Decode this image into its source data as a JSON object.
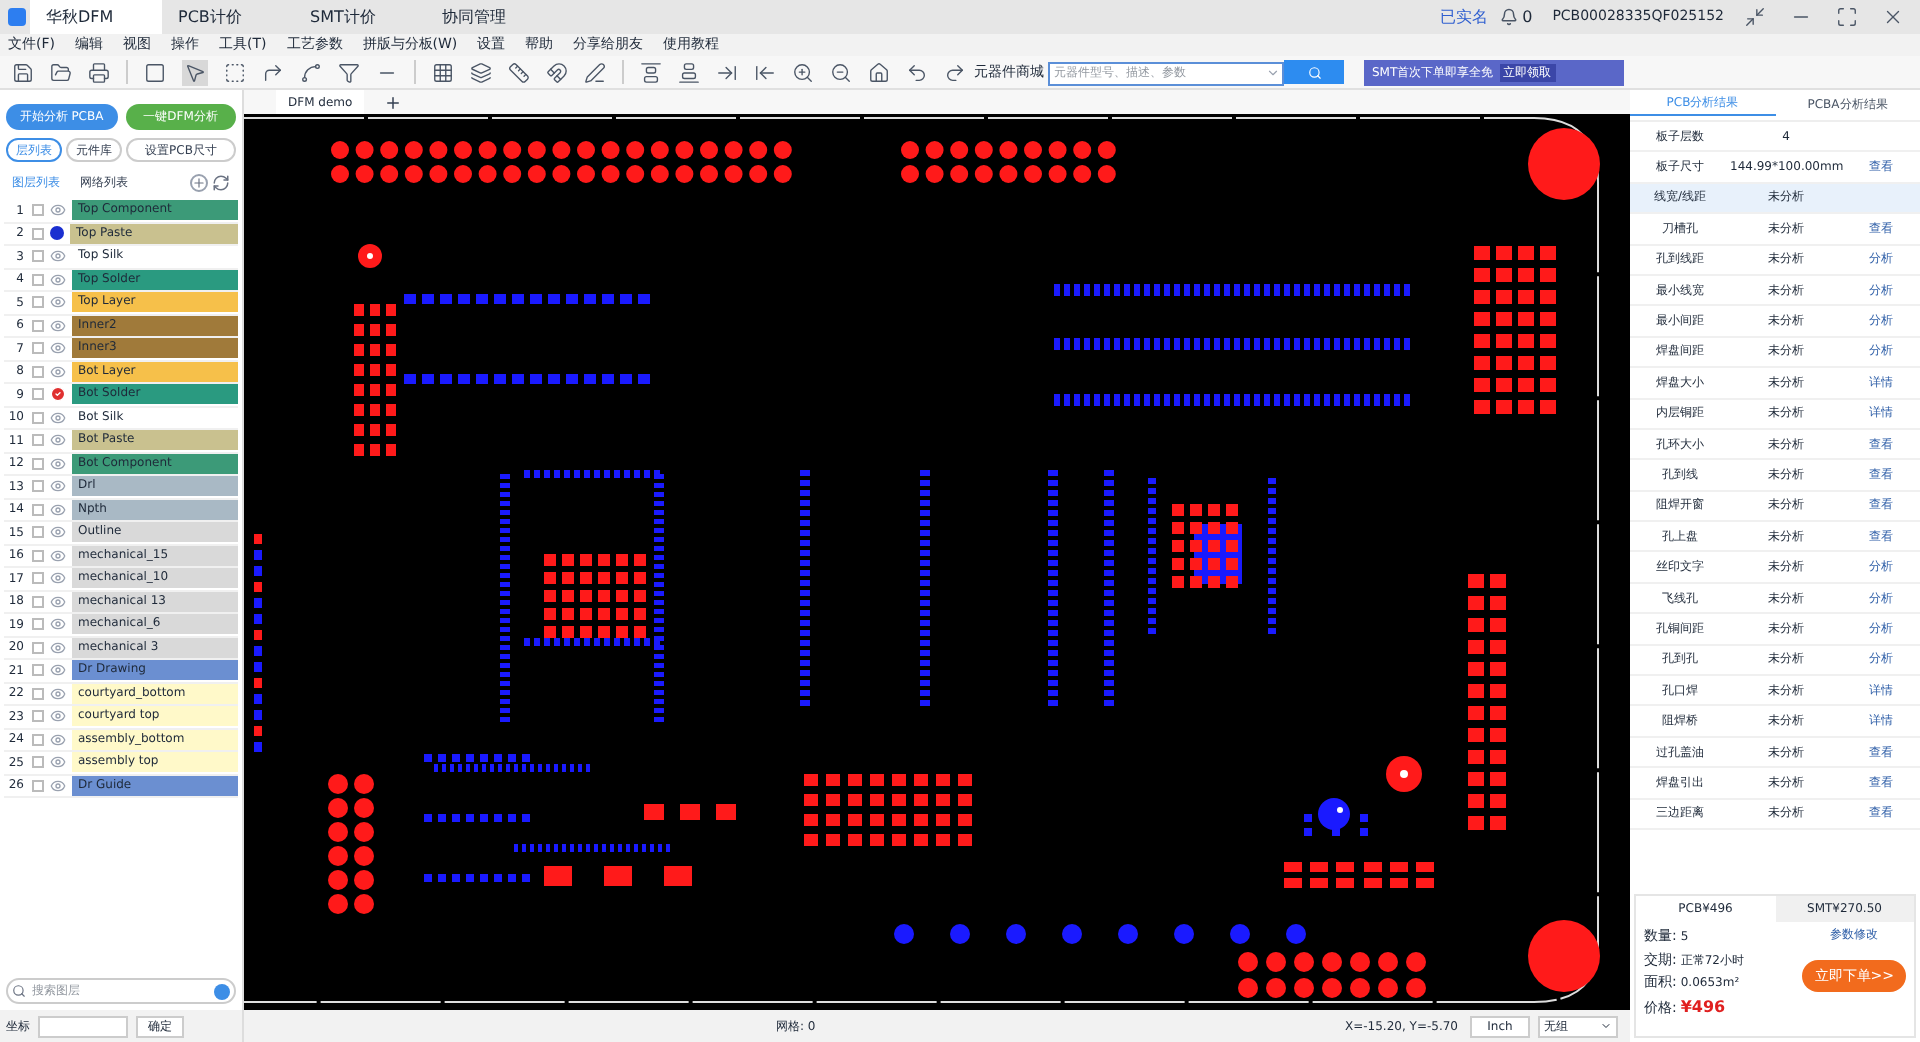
{
  "app_tabs": [
    {
      "label": "华秋DFM",
      "selected": true
    },
    {
      "label": "PCB计价",
      "selected": false
    },
    {
      "label": "SMT计价",
      "selected": false
    },
    {
      "label": "协同管理",
      "selected": false
    }
  ],
  "account": {
    "verified": "已实名",
    "notifications": "0",
    "user": "PCB00028335QF025152"
  },
  "menu": [
    "文件(F)",
    "编辑",
    "视图",
    "操作",
    "工具(T)",
    "工艺参数",
    "拼版与分板(W)",
    "设置",
    "帮助",
    "分享给朋友",
    "使用教程"
  ],
  "parts_search": {
    "label": "元器件商城",
    "placeholder": "元器件型号、描述、参数"
  },
  "banner": {
    "text": "SMT首次下单即享全免",
    "action": "立即领取"
  },
  "actions": [
    "开始分析 PCBA",
    "一键DFM分析"
  ],
  "left_tabs": [
    {
      "label": "层列表",
      "selected": true
    },
    {
      "label": "元件库",
      "selected": false
    },
    {
      "label": "设置PCB尺寸",
      "selected": false
    }
  ],
  "layer_header": {
    "tabs": [
      {
        "label": "图层列表",
        "selected": true
      },
      {
        "label": "网络列表",
        "selected": false
      }
    ]
  },
  "layers": [
    {
      "index": "1",
      "name": "Top Component",
      "color": "#3c9a78",
      "kind": "eye",
      "checked": false
    },
    {
      "index": "2",
      "name": "Top Paste",
      "color": "#c9c18f",
      "kind": "current",
      "checked": false
    },
    {
      "index": "3",
      "name": "Top Silk",
      "color": "#ffffff",
      "kind": "eye",
      "checked": false
    },
    {
      "index": "4",
      "name": "Top Solder",
      "color": "#2a9a80",
      "kind": "eye",
      "checked": false
    },
    {
      "index": "5",
      "name": "Top Layer",
      "color": "#f6c04a",
      "kind": "eye",
      "checked": false
    },
    {
      "index": "6",
      "name": "Inner2",
      "color": "#a07a3a",
      "kind": "eye",
      "checked": false
    },
    {
      "index": "7",
      "name": "Inner3",
      "color": "#a07a3a",
      "kind": "eye",
      "checked": false
    },
    {
      "index": "8",
      "name": "Bot Layer",
      "color": "#f6c04a",
      "kind": "eye",
      "checked": false
    },
    {
      "index": "9",
      "name": "Bot Solder",
      "color": "#2a9a80",
      "kind": "warning",
      "checked": false
    },
    {
      "index": "10",
      "name": "Bot Silk",
      "color": "#ffffff",
      "kind": "eye",
      "checked": false
    },
    {
      "index": "11",
      "name": "Bot Paste",
      "color": "#c9c18f",
      "kind": "eye",
      "checked": false
    },
    {
      "index": "12",
      "name": "Bot Component",
      "color": "#3c9a78",
      "kind": "eye",
      "checked": false
    },
    {
      "index": "13",
      "name": "Drl",
      "color": "#a9b9c5",
      "kind": "eye",
      "checked": false
    },
    {
      "index": "14",
      "name": "Npth",
      "color": "#a9b9c5",
      "kind": "eye",
      "checked": false
    },
    {
      "index": "15",
      "name": "Outline",
      "color": "#d9d9d9",
      "kind": "eye",
      "checked": false
    },
    {
      "index": "16",
      "name": "mechanical_15",
      "color": "#d9d9d9",
      "kind": "eye",
      "checked": false
    },
    {
      "index": "17",
      "name": "mechanical_10",
      "color": "#d9d9d9",
      "kind": "eye",
      "checked": false
    },
    {
      "index": "18",
      "name": "mechanical 13",
      "color": "#d9d9d9",
      "kind": "eye",
      "checked": false
    },
    {
      "index": "19",
      "name": "mechanical_6",
      "color": "#d9d9d9",
      "kind": "eye",
      "checked": false
    },
    {
      "index": "20",
      "name": "mechanical 3",
      "color": "#d9d9d9",
      "kind": "eye",
      "checked": false
    },
    {
      "index": "21",
      "name": "Dr Drawing",
      "color": "#6b8fd1",
      "kind": "eye",
      "checked": false
    },
    {
      "index": "22",
      "name": "courtyard_bottom",
      "color": "#fff9c9",
      "kind": "eye",
      "checked": false
    },
    {
      "index": "23",
      "name": "courtyard top",
      "color": "#fff9c9",
      "kind": "eye",
      "checked": false
    },
    {
      "index": "24",
      "name": "assembly_bottom",
      "color": "#fff9c9",
      "kind": "eye",
      "checked": false
    },
    {
      "index": "25",
      "name": "assembly top",
      "color": "#fff9c9",
      "kind": "eye",
      "checked": false
    },
    {
      "index": "26",
      "name": "Dr Guide",
      "color": "#6b8fd1",
      "kind": "eye",
      "checked": false
    }
  ],
  "layer_search": {
    "placeholder": "搜索图层"
  },
  "coordinate": {
    "label": "坐标",
    "button": "确定"
  },
  "doc_tabs": [
    {
      "label": "DFM demo",
      "selected": true
    }
  ],
  "status_bar": {
    "grid": "网格: 0",
    "position": "X=-15.20, Y=-5.70",
    "unit": "Inch",
    "mode": "无组"
  },
  "result_tabs": [
    {
      "label": "PCB分析结果",
      "selected": true
    },
    {
      "label": "PCBA分析结果",
      "selected": false
    }
  ],
  "results": [
    {
      "item": "板子层数",
      "value": "4",
      "selected": false
    },
    {
      "item": "板子尺寸",
      "value": "144.99*100.00mm",
      "action": "查看",
      "selected": false
    },
    {
      "item": "线宽/线距",
      "value": "未分析",
      "selected": true
    },
    {
      "item": "刀槽孔",
      "value": "未分析",
      "action": "查看",
      "selected": false
    },
    {
      "item": "孔到线距",
      "value": "未分析",
      "action": "分析",
      "selected": false
    },
    {
      "item": "最小线宽",
      "value": "未分析",
      "action": "分析",
      "selected": false
    },
    {
      "item": "最小间距",
      "value": "未分析",
      "action": "分析",
      "selected": false
    },
    {
      "item": "焊盘间距",
      "value": "未分析",
      "action": "分析",
      "selected": false
    },
    {
      "item": "焊盘大小",
      "value": "未分析",
      "action": "详情",
      "selected": false
    },
    {
      "item": "内层铜距",
      "value": "未分析",
      "action": "详情",
      "selected": false
    },
    {
      "item": "孔环大小",
      "value": "未分析",
      "action": "查看",
      "selected": false
    },
    {
      "item": "孔到线",
      "value": "未分析",
      "action": "查看",
      "selected": false
    },
    {
      "item": "阻焊开窗",
      "value": "未分析",
      "action": "查看",
      "selected": false
    },
    {
      "item": "孔上盘",
      "value": "未分析",
      "action": "查看",
      "selected": false
    },
    {
      "item": "丝印文字",
      "value": "未分析",
      "action": "分析",
      "selected": false
    },
    {
      "item": "飞线孔",
      "value": "未分析",
      "action": "分析",
      "selected": false
    },
    {
      "item": "孔铜间距",
      "value": "未分析",
      "action": "分析",
      "selected": false
    },
    {
      "item": "孔到孔",
      "value": "未分析",
      "action": "分析",
      "selected": false
    },
    {
      "item": "孔口焊",
      "value": "未分析",
      "action": "详情",
      "selected": false
    },
    {
      "item": "阻焊桥",
      "value": "未分析",
      "action": "详情",
      "selected": false
    },
    {
      "item": "过孔盖油",
      "value": "未分析",
      "action": "查看",
      "selected": false
    },
    {
      "item": "焊盘引出",
      "value": "未分析",
      "action": "查看",
      "selected": false
    },
    {
      "item": "三边距离",
      "value": "未分析",
      "action": "查看",
      "selected": false
    }
  ],
  "quote": {
    "tabs": [
      {
        "label": "PCB¥496",
        "selected": true
      },
      {
        "label": "SMT¥270.50",
        "selected": false
      }
    ],
    "fields": [
      {
        "label": "数量:",
        "value": "5"
      },
      {
        "label": "交期:",
        "value": "正常72小时"
      },
      {
        "label": "面积:",
        "value": "0.0653m²"
      },
      {
        "label": "价格:",
        "value": "¥496",
        "kind": "price"
      }
    ],
    "edit_link": "参数修改",
    "order_button": "立即下单>>"
  }
}
